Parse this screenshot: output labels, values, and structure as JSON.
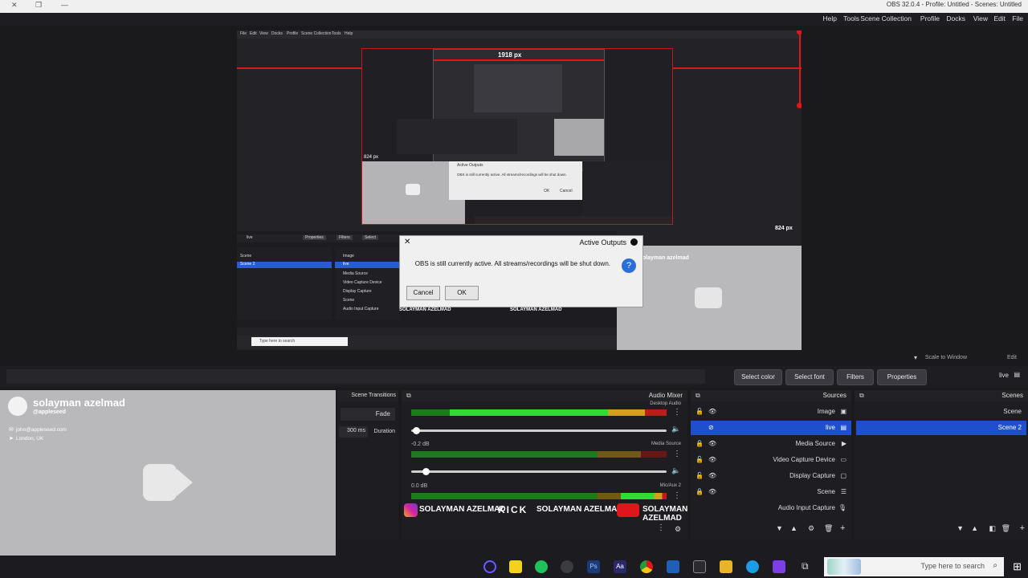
{
  "window": {
    "title": "OBS 32.0.4 - Profile: Untitled - Scenes: Untitled"
  },
  "menu": [
    "File",
    "Edit",
    "View",
    "Docks",
    "Profile",
    "Scene Collection",
    "Tools",
    "Help"
  ],
  "preview": {
    "nested_menu": [
      "File",
      "Edit",
      "View",
      "Docks",
      "Profile",
      "Scene Collection",
      "Tools",
      "Help"
    ],
    "dim_width": "1918 px",
    "dim_height": "824 px",
    "dim_small": "824 px",
    "source_toolbar": {
      "source": "live",
      "properties": "Properties",
      "filters": "Filters",
      "select": "Select"
    },
    "scenes": [
      "Scene",
      "Scene 2"
    ],
    "sources": [
      "Image",
      "live",
      "Media Source",
      "Video Capture Device",
      "Display Capture",
      "Scene",
      "Audio Input Capture"
    ],
    "taskbar_search": "Type here to search"
  },
  "dialog": {
    "title": "Active Outputs",
    "message": "OBS is still currently active. All streams/recordings will be shut down.",
    "cancel": "Cancel",
    "ok": "OK"
  },
  "small_dialog": {
    "title": "Active Outputs",
    "message": "OBS is still currently active. All streams/recordings will be shut down.",
    "ok": "OK",
    "cancel": "Cancel"
  },
  "profile": {
    "name": "solayman azelmad",
    "handle": "@appleseed",
    "email": "john@appleseed.com",
    "location": "London, UK"
  },
  "scale_bar": {
    "label": "Scale to Window",
    "fit": "Edit"
  },
  "source_bar": {
    "source": "live",
    "properties": "Properties",
    "filters": "Filters",
    "select_color": "Select color",
    "select_font": "Select font"
  },
  "docks": {
    "scenes_title": "Scenes",
    "sources_title": "Sources",
    "mixer_title": "Audio Mixer",
    "transitions_title": "Scene Transitions"
  },
  "scenes": [
    {
      "name": "Scene",
      "selected": false
    },
    {
      "name": "Scene 2",
      "selected": true
    }
  ],
  "sources": [
    {
      "name": "Image",
      "locked": false
    },
    {
      "name": "live",
      "locked": false,
      "selected": true
    },
    {
      "name": "Media Source",
      "locked": true
    },
    {
      "name": "Video Capture Device",
      "locked": false
    },
    {
      "name": "Display Capture",
      "locked": false
    },
    {
      "name": "Scene",
      "locked": true
    },
    {
      "name": "Audio Input Capture",
      "locked": false
    }
  ],
  "mixer": {
    "channels": [
      {
        "name": "Desktop Audio",
        "db": "",
        "level": 0.85
      },
      {
        "name": "Media Source",
        "db": "-0.2 dB",
        "level": 0.0
      },
      {
        "name": "Mic/Aux 2",
        "db": "0.0 dB",
        "level": 0.18
      }
    ],
    "scale": [
      "-60",
      "-55",
      "-50",
      "-45",
      "-40",
      "-35",
      "-30",
      "-25",
      "-20",
      "-15",
      "-10",
      "-5",
      "0"
    ]
  },
  "transitions": {
    "type": "Fade",
    "duration_label": "Duration",
    "duration_value": "300 ms"
  },
  "banner": {
    "segments": [
      "SOLAYMAN AZELMAD",
      "SOLAYMAN AZELMAD",
      "SOLAYMAN AZELMAD"
    ],
    "kick": "KICK"
  },
  "taskbar": {
    "search": "Type here to search"
  },
  "colors": {
    "accent": "#2a5bd7",
    "selection": "#1f4fcf",
    "record_red": "#e0171a"
  }
}
